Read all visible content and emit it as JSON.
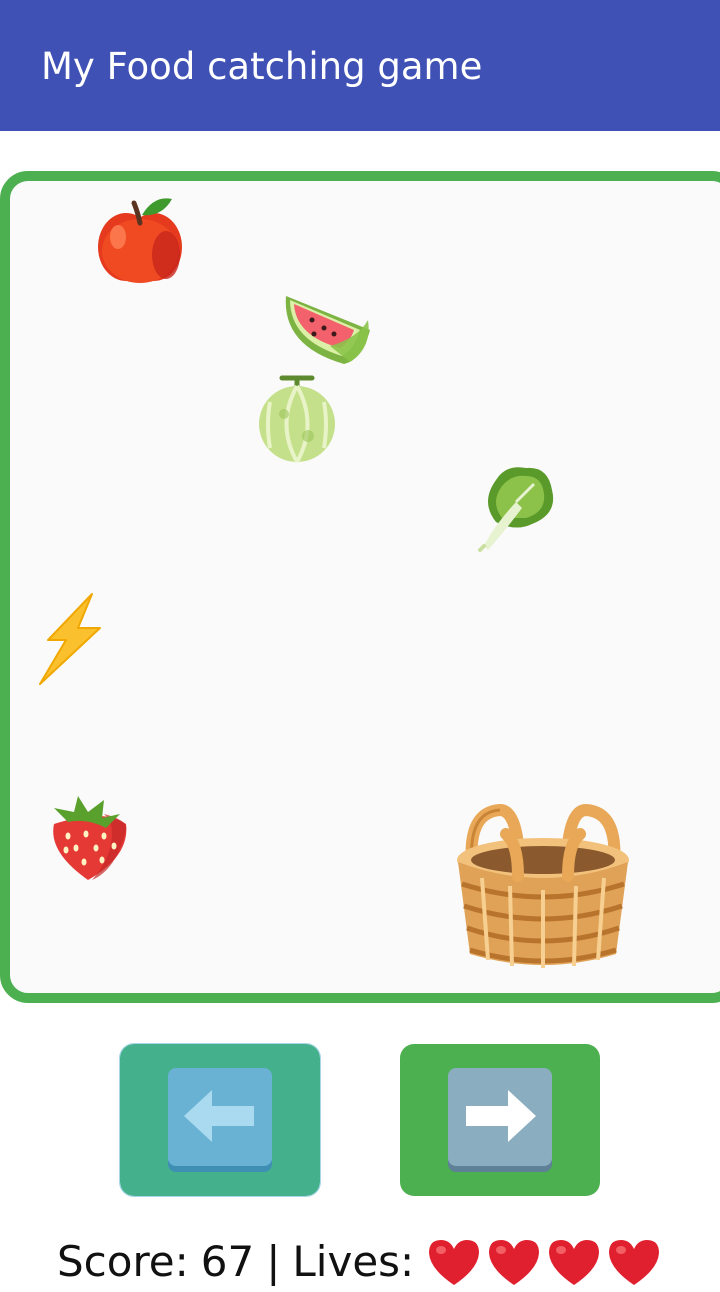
{
  "app": {
    "title": "My Food catching game"
  },
  "game": {
    "items": [
      {
        "name": "apple",
        "icon": "apple-icon"
      },
      {
        "name": "watermelon",
        "icon": "watermelon-icon"
      },
      {
        "name": "melon",
        "icon": "melon-icon"
      },
      {
        "name": "lettuce",
        "icon": "lettuce-icon"
      },
      {
        "name": "lightning",
        "icon": "lightning-icon"
      },
      {
        "name": "strawberry",
        "icon": "strawberry-icon"
      }
    ],
    "player": {
      "icon": "basket-icon"
    }
  },
  "controls": {
    "left": {
      "icon": "left-arrow-icon"
    },
    "right": {
      "icon": "right-arrow-icon"
    }
  },
  "status": {
    "score_label": "Score:",
    "score": "67",
    "separator": "|",
    "lives_label": "Lives:",
    "lives": 4
  },
  "colors": {
    "app_bar": "#3f51b5",
    "game_border": "#4caf50",
    "game_background": "#fafafa",
    "left_button": "#45b08c",
    "right_button": "#4caf50",
    "heart": "#e0202e"
  }
}
